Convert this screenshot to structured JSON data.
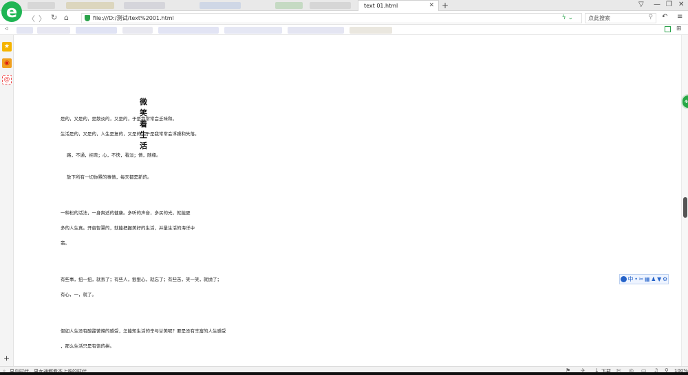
{
  "browser": {
    "logo_letter": "e",
    "tab_title": "text 01.html",
    "tab_close": "✕",
    "new_tab": "+",
    "address": "file:///D:/测试/text%2001.html",
    "search_placeholder": "点此搜索",
    "accent": "#1fb553"
  },
  "page": {
    "title": "微笑着生活",
    "lines": [
      "是的，又是的，是散淡的，又是的，于是我常常会乏味和。",
      "生活是的，又是的，人生是复的，又是的，于是我常常会浮躁和失落。",
      "路，不通，拐弯；心，不快，看淡；情，随缘。",
      "放下所有一切你累的事情，每天都是新的。",
      "一种松的活法，一身爽适的健康。多听的声音，多买的光，就能更",
      "多的人生真。开启智慧的，就能把握美好的生活，并量生活的海洋中",
      "翡。",
      "有些事，扭一扭，就丢了；有些人，狠狠心，就忘了；有些苦，笑一笑，就抛了；",
      "有心，一，就了。",
      "假如人生没有酸甜苦辣的感受，怎能知生活的辛与甘美呢？要是没有丰富的人生感受",
      "，那么生活只是有饱的拼。"
    ]
  },
  "sidebar": {
    "favorites_icon": "★",
    "weibo_icon": "◉",
    "mail_icon": "@",
    "add_label": "+"
  },
  "widgets": {
    "speed_ball_label": "46",
    "ime_items": [
      "中",
      "•",
      "⚙"
    ]
  },
  "status": {
    "news_text": "早鸟时代，男女通都看不上谁的时代",
    "download_label": "下载",
    "zoom_label": "100%"
  }
}
